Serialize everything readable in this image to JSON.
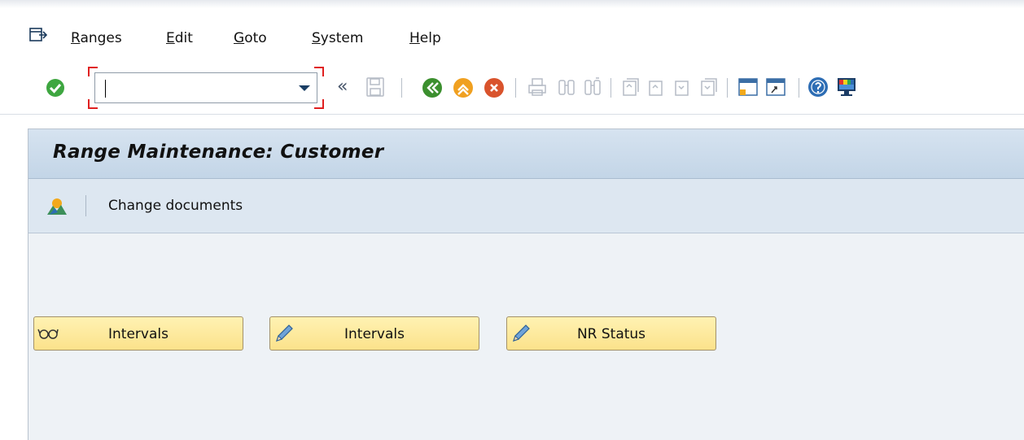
{
  "menu": {
    "items": [
      {
        "label": "Ranges"
      },
      {
        "label": "Edit"
      },
      {
        "label": "Goto"
      },
      {
        "label": "System"
      },
      {
        "label": "Help"
      }
    ]
  },
  "toolbar": {
    "command_field": {
      "value": ""
    },
    "collapse_symbol": "«"
  },
  "window": {
    "title": "Range Maintenance: Customer",
    "app_toolbar": {
      "change_documents_label": "Change documents"
    }
  },
  "buttons": [
    {
      "label": "Intervals",
      "icon": "glasses-icon"
    },
    {
      "label": "Intervals",
      "icon": "pencil-icon"
    },
    {
      "label": "NR Status",
      "icon": "pencil-icon"
    }
  ],
  "colors": {
    "title_bar": "#c3d5e7",
    "button_fill": "#fbe28b",
    "ok_green": "#3ea640",
    "command_bracket": "#e02020"
  }
}
